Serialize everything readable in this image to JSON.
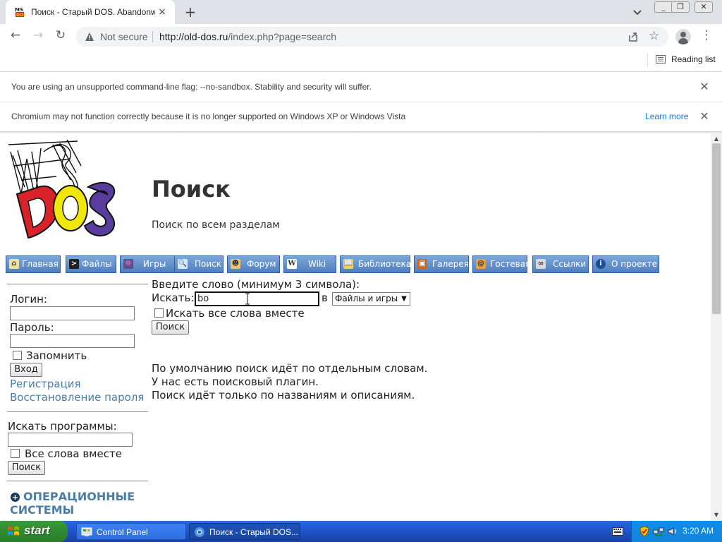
{
  "browser": {
    "tab_title": "Поиск - Старый DOS. Abandonware",
    "tab_close_glyph": "×",
    "new_tab_glyph": "+",
    "window_buttons": [
      "_",
      "❐",
      "✕"
    ],
    "nav_glyphs": {
      "back": "←",
      "forward": "→",
      "reload": "↻"
    },
    "security_label": "Not secure",
    "url_host": "http://old-dos.ru",
    "url_path": "/index.php?page=search",
    "star_glyph": "☆",
    "menu_glyph": "⋮",
    "reading_list_label": "Reading list",
    "infobars": [
      {
        "message": "You are using an unsupported command-line flag: --no-sandbox. Stability and security will suffer.",
        "close_glyph": "✕"
      },
      {
        "message": "Chromium may not function correctly because it is no longer supported on Windows XP or Windows Vista",
        "learn_more": "Learn more",
        "close_glyph": "✕"
      }
    ]
  },
  "page": {
    "title": "Поиск",
    "subtitle": "Поиск по всем разделам",
    "nav": [
      {
        "label": "Главная",
        "icon": "home-icon",
        "color": "#f0e0a0",
        "glyph": "⌂"
      },
      {
        "label": "Файлы",
        "icon": "terminal-icon",
        "color": "#202020",
        "glyph": ">"
      },
      {
        "label": "Игры",
        "icon": "invader-icon",
        "color": "#5a4e8a",
        "glyph": "👾"
      },
      {
        "label": "Поиск",
        "icon": "magnifier-icon",
        "color": "#d8e8f8",
        "glyph": "🔍"
      },
      {
        "label": "Форум",
        "icon": "user-icon",
        "color": "#e9c27a",
        "glyph": "☻"
      },
      {
        "label": "Wiki",
        "icon": "wiki-icon",
        "color": "#ffffff",
        "glyph": "W"
      },
      {
        "label": "Библиотека",
        "icon": "book-icon",
        "color": "#e8d26a",
        "glyph": "📖"
      },
      {
        "label": "Галерея",
        "icon": "picture-icon",
        "color": "#c46a2a",
        "glyph": "▣"
      },
      {
        "label": "Гостевая",
        "icon": "guestbook-icon",
        "color": "#e8a040",
        "glyph": "@"
      },
      {
        "label": "Ссылки",
        "icon": "link-icon",
        "color": "#d8d8d8",
        "glyph": "∞"
      },
      {
        "label": "О проекте",
        "icon": "info-icon",
        "color": "#1d4f9a",
        "glyph": "i"
      }
    ],
    "login": {
      "login_label": "Логин:",
      "password_label": "Пароль:",
      "remember_label": "Запомнить",
      "enter_button": "Вход",
      "register_link": "Регистрация",
      "restore_link": "Восстановление пароля"
    },
    "program_search": {
      "label": "Искать программы:",
      "all_words_label": "Все слова вместе",
      "button": "Поиск"
    },
    "os_section": {
      "plus_glyph": "+",
      "heading": "ОПЕРАЦИОННЫЕ СИСТЕМЫ"
    },
    "search_form": {
      "intro": "Введите слово (минимум 3 символа):",
      "search_label": "Искать:",
      "query_value": "bo",
      "in_label": "в",
      "scope_selected": "Файлы и игры",
      "all_words_label": "Искать все слова вместе",
      "button": "Поиск"
    },
    "notes": [
      "По умолчанию поиск идёт по отдельным словам.",
      "У нас есть поисковый плагин.",
      "Поиск идёт только по названиям и описаниям."
    ]
  },
  "taskbar": {
    "start_label": "start",
    "tasks": [
      {
        "label": "Control Panel",
        "active": false
      },
      {
        "label": "Поиск - Старый DOS...",
        "active": true
      }
    ],
    "clock": "3:20 AM"
  }
}
